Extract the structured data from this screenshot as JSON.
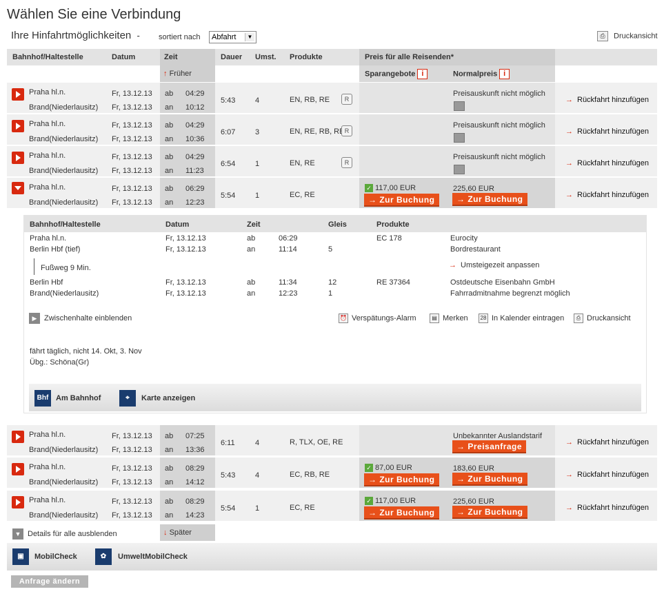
{
  "page": {
    "title": "Wählen Sie eine Verbindung",
    "subtitle": "Ihre Hinfahrtmöglichkeiten",
    "dash": "-",
    "sorted_label": "sortiert nach",
    "sort_value": "Abfahrt",
    "print": "Druckansicht"
  },
  "header": {
    "station": "Bahnhof/Haltestelle",
    "date": "Datum",
    "time": "Zeit",
    "duration": "Dauer",
    "changes": "Umst.",
    "products": "Produkte",
    "price": "Preis für alle Reisenden*",
    "earlier": "Früher",
    "saver": "Sparangebote",
    "normal": "Normalpreis",
    "later": "Später"
  },
  "rows": [
    {
      "from": "Praha hl.n.",
      "to": "Brand(Niederlausitz)",
      "d1": "Fr, 13.12.13",
      "d2": "Fr, 13.12.13",
      "ab": "ab",
      "an": "an",
      "t1": "04:29",
      "t2": "10:12",
      "dur": "5:43",
      "ch": "4",
      "prod": "EN, RB, RE",
      "price_text": "Preisauskunft nicht möglich",
      "return": "Rückfahrt hinzufügen"
    },
    {
      "from": "Praha hl.n.",
      "to": "Brand(Niederlausitz)",
      "d1": "Fr, 13.12.13",
      "d2": "Fr, 13.12.13",
      "ab": "ab",
      "an": "an",
      "t1": "04:29",
      "t2": "10:36",
      "dur": "6:07",
      "ch": "3",
      "prod": "EN, RE, RB, RE",
      "price_text": "Preisauskunft nicht möglich",
      "return": "Rückfahrt hinzufügen"
    },
    {
      "from": "Praha hl.n.",
      "to": "Brand(Niederlausitz)",
      "d1": "Fr, 13.12.13",
      "d2": "Fr, 13.12.13",
      "ab": "ab",
      "an": "an",
      "t1": "04:29",
      "t2": "11:23",
      "dur": "6:54",
      "ch": "1",
      "prod": "EN, RE",
      "price_text": "Preisauskunft nicht möglich",
      "return": "Rückfahrt hinzufügen"
    },
    {
      "from": "Praha hl.n.",
      "to": "Brand(Niederlausitz)",
      "d1": "Fr, 13.12.13",
      "d2": "Fr, 13.12.13",
      "ab": "ab",
      "an": "an",
      "t1": "06:29",
      "t2": "12:23",
      "dur": "5:54",
      "ch": "1",
      "prod": "EC, RE",
      "saver": "117,00 EUR",
      "normal": "225,60 EUR",
      "book": "Zur Buchung",
      "return": "Rückfahrt hinzufügen"
    },
    {
      "from": "Praha hl.n.",
      "to": "Brand(Niederlausitz)",
      "d1": "Fr, 13.12.13",
      "d2": "Fr, 13.12.13",
      "ab": "ab",
      "an": "an",
      "t1": "07:25",
      "t2": "13:36",
      "dur": "6:11",
      "ch": "4",
      "prod": "R, TLX, OE, RE",
      "price_text": "Unbekannter Auslandstarif",
      "request": "Preisanfrage",
      "return": "Rückfahrt hinzufügen"
    },
    {
      "from": "Praha hl.n.",
      "to": "Brand(Niederlausitz)",
      "d1": "Fr, 13.12.13",
      "d2": "Fr, 13.12.13",
      "ab": "ab",
      "an": "an",
      "t1": "08:29",
      "t2": "14:12",
      "dur": "5:43",
      "ch": "4",
      "prod": "EC, RB, RE",
      "saver": "87,00 EUR",
      "normal": "183,60 EUR",
      "book": "Zur Buchung",
      "return": "Rückfahrt hinzufügen"
    },
    {
      "from": "Praha hl.n.",
      "to": "Brand(Niederlausitz)",
      "d1": "Fr, 13.12.13",
      "d2": "Fr, 13.12.13",
      "ab": "ab",
      "an": "an",
      "t1": "08:29",
      "t2": "14:23",
      "dur": "5:54",
      "ch": "1",
      "prod": "EC, RE",
      "saver": "117,00 EUR",
      "normal": "225,60 EUR",
      "book": "Zur Buchung",
      "return": "Rückfahrt hinzufügen"
    }
  ],
  "detail": {
    "hdr": {
      "station": "Bahnhof/Haltestelle",
      "date": "Datum",
      "time": "Zeit",
      "track": "Gleis",
      "products": "Produkte"
    },
    "lines": [
      {
        "st": "Praha hl.n.",
        "d": "Fr, 13.12.13",
        "t": "ab",
        "tm": "06:29",
        "g": "",
        "p": "EC 178",
        "n": "Eurocity"
      },
      {
        "st": "Berlin Hbf (tief)",
        "d": "Fr, 13.12.13",
        "t": "an",
        "tm": "11:14",
        "g": "5",
        "p": "",
        "n": "Bordrestaurant"
      },
      {
        "st": "Berlin Hbf",
        "d": "Fr, 13.12.13",
        "t": "ab",
        "tm": "11:34",
        "g": "12",
        "p": "RE 37364",
        "n": "Ostdeutsche Eisenbahn GmbH"
      },
      {
        "st": "Brand(Niederlausitz)",
        "d": "Fr, 13.12.13",
        "t": "an",
        "tm": "12:23",
        "g": "1",
        "p": "",
        "n": "Fahrradmitnahme begrenzt möglich"
      }
    ],
    "walk": "Fußweg",
    "walk_time": "9 Min.",
    "adjust": "Umsteigezeit anpassen",
    "stops": "Zwischenhalte einblenden",
    "alarm": "Verspätungs-Alarm",
    "save": "Merken",
    "calendar": "In Kalender eintragen",
    "print": "Druckansicht",
    "note1": "fährt täglich, nicht 14. Okt, 3. Nov",
    "note2": "Übg.: Schöna(Gr)",
    "station_btn": "Am Bahnhof",
    "map_btn": "Karte anzeigen",
    "bhf_icon_text": "Bhf"
  },
  "footer": {
    "hide_details": "Details für alle ausblenden",
    "mobil": "MobilCheck",
    "umwelt": "UmweltMobilCheck",
    "change": "Anfrage ändern"
  }
}
